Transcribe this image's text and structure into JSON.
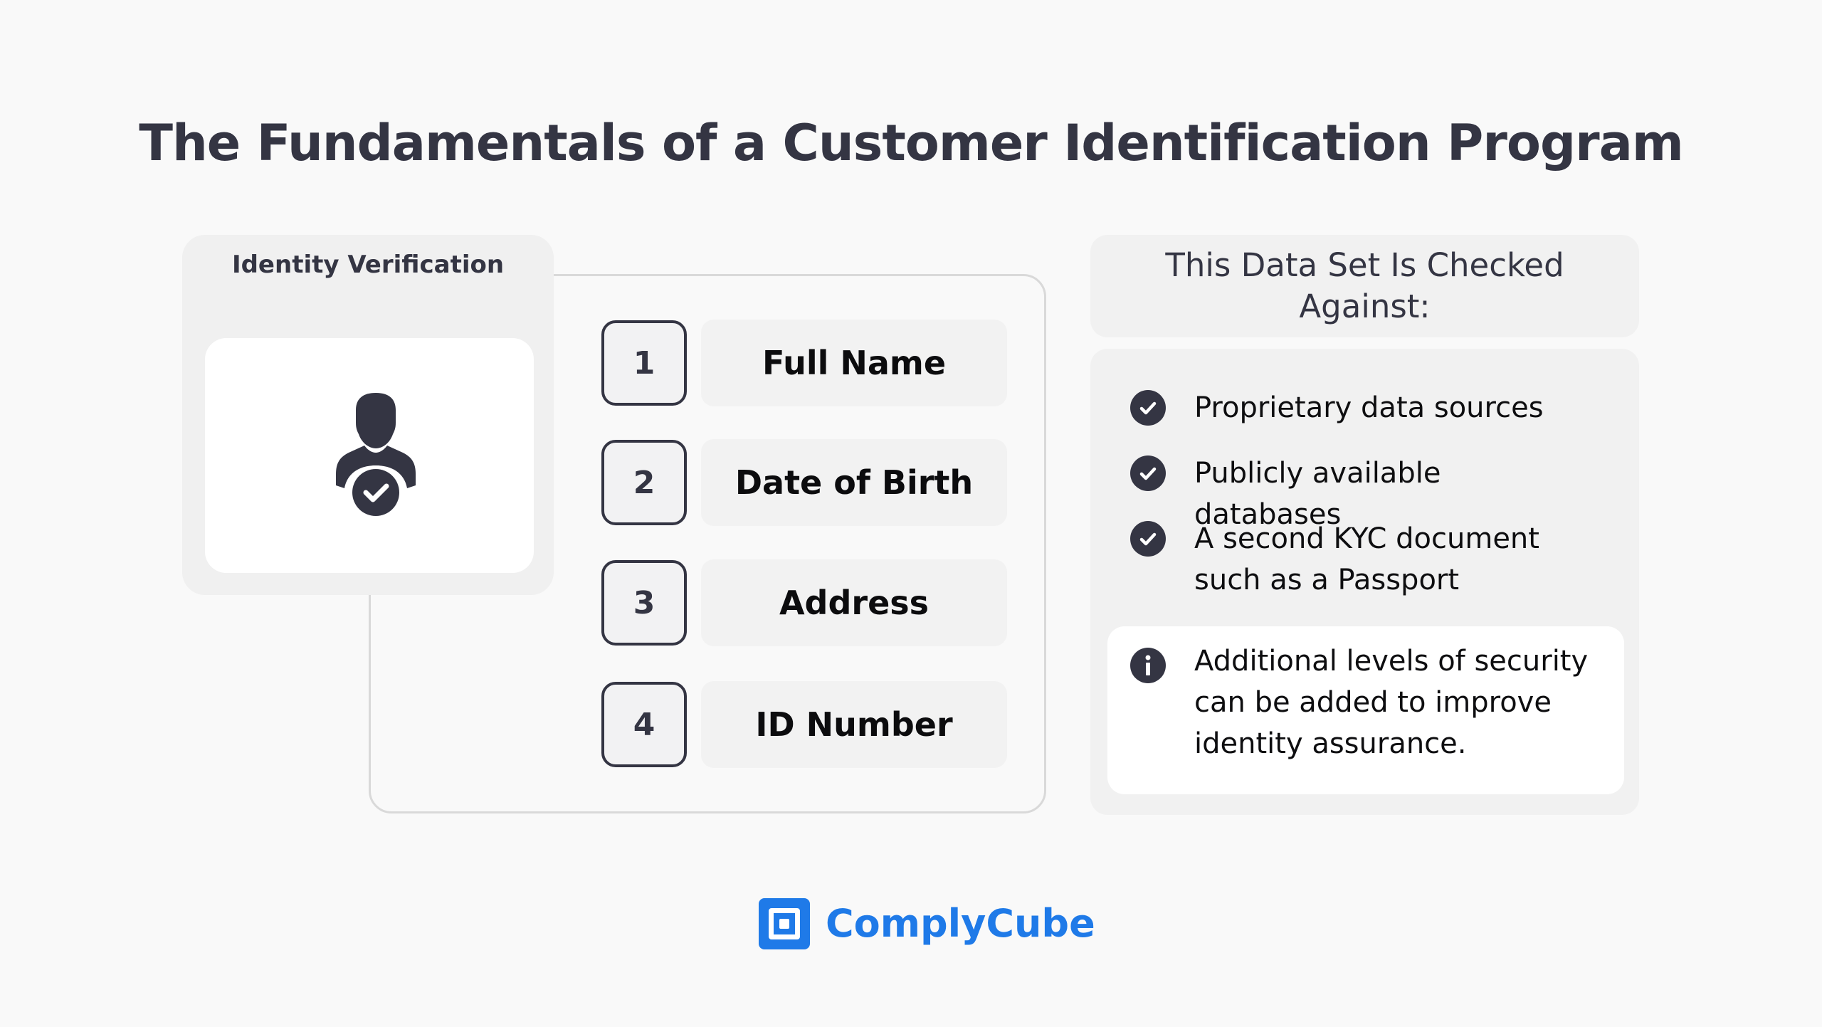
{
  "title": "The Fundamentals of a Customer Identification Program",
  "identity_card": {
    "title": "Identity Verification",
    "icon": "verified-user-icon"
  },
  "fields": [
    {
      "number": "1",
      "label": "Full Name"
    },
    {
      "number": "2",
      "label": "Date of Birth"
    },
    {
      "number": "3",
      "label": "Address"
    },
    {
      "number": "4",
      "label": "ID Number"
    }
  ],
  "checked_against": {
    "heading": "This Data Set Is Checked Against:",
    "items": [
      {
        "icon": "check-circle-icon",
        "text": "Proprietary data sources"
      },
      {
        "icon": "check-circle-icon",
        "text": "Publicly available databases"
      },
      {
        "icon": "check-circle-icon",
        "text": "A second KYC document such as a Passport"
      }
    ],
    "note": {
      "icon": "info-icon",
      "text": "Additional levels of security can be added to improve identity assurance."
    }
  },
  "brand": {
    "name": "ComplyCube",
    "color": "#1f7ae8"
  },
  "colors": {
    "text_dark": "#343543",
    "card_bg": "#f1f1f1",
    "background": "#f9f9f9"
  }
}
